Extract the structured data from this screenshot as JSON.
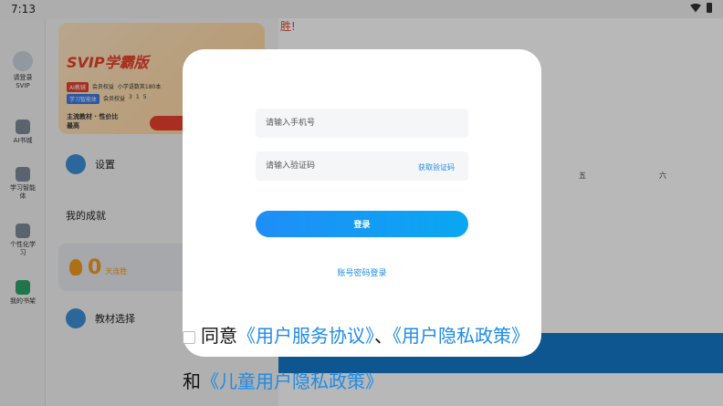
{
  "status": {
    "time": "7:13"
  },
  "rail": {
    "items": [
      {
        "label": "请登录",
        "sub": "SVIP"
      },
      {
        "label": "AI书城"
      },
      {
        "label": "学习智能体"
      },
      {
        "label": "个性化学习"
      },
      {
        "label": "我的书架"
      }
    ]
  },
  "panel": {
    "svip_title": "SVIP学霸版",
    "row1_tag": "AI教辅",
    "row1_text1": "会员权益",
    "row1_text2": "小学语数英180本",
    "row2_tag": "学习智能体",
    "row2_text1": "会员权益",
    "row2_vals": [
      "3",
      "1",
      "5"
    ],
    "foot_line1": "主流教材 · 性价比",
    "foot_line2": "最高",
    "settings_label": "设置",
    "achievement_title": "我的成就",
    "streak_value": "0",
    "streak_label": "天连胜",
    "textbook_label": "教材选择"
  },
  "right": {
    "red_text": "胜!",
    "weekdays": [
      "五",
      "六"
    ]
  },
  "dialog": {
    "phone_placeholder": "请输入手机号",
    "code_placeholder": "请输入验证码",
    "get_code": "获取验证码",
    "login_button": "登录",
    "password_login": "账号密码登录"
  },
  "agreement": {
    "prefix": "同意",
    "service": "《用户服务协议》",
    "sep": "、",
    "privacy": "《用户隐私政策》",
    "and": "和",
    "child_privacy": "《儿童用户隐私政策》"
  },
  "colors": {
    "accent": "#1e8be6",
    "svip_red": "#e8412f"
  }
}
